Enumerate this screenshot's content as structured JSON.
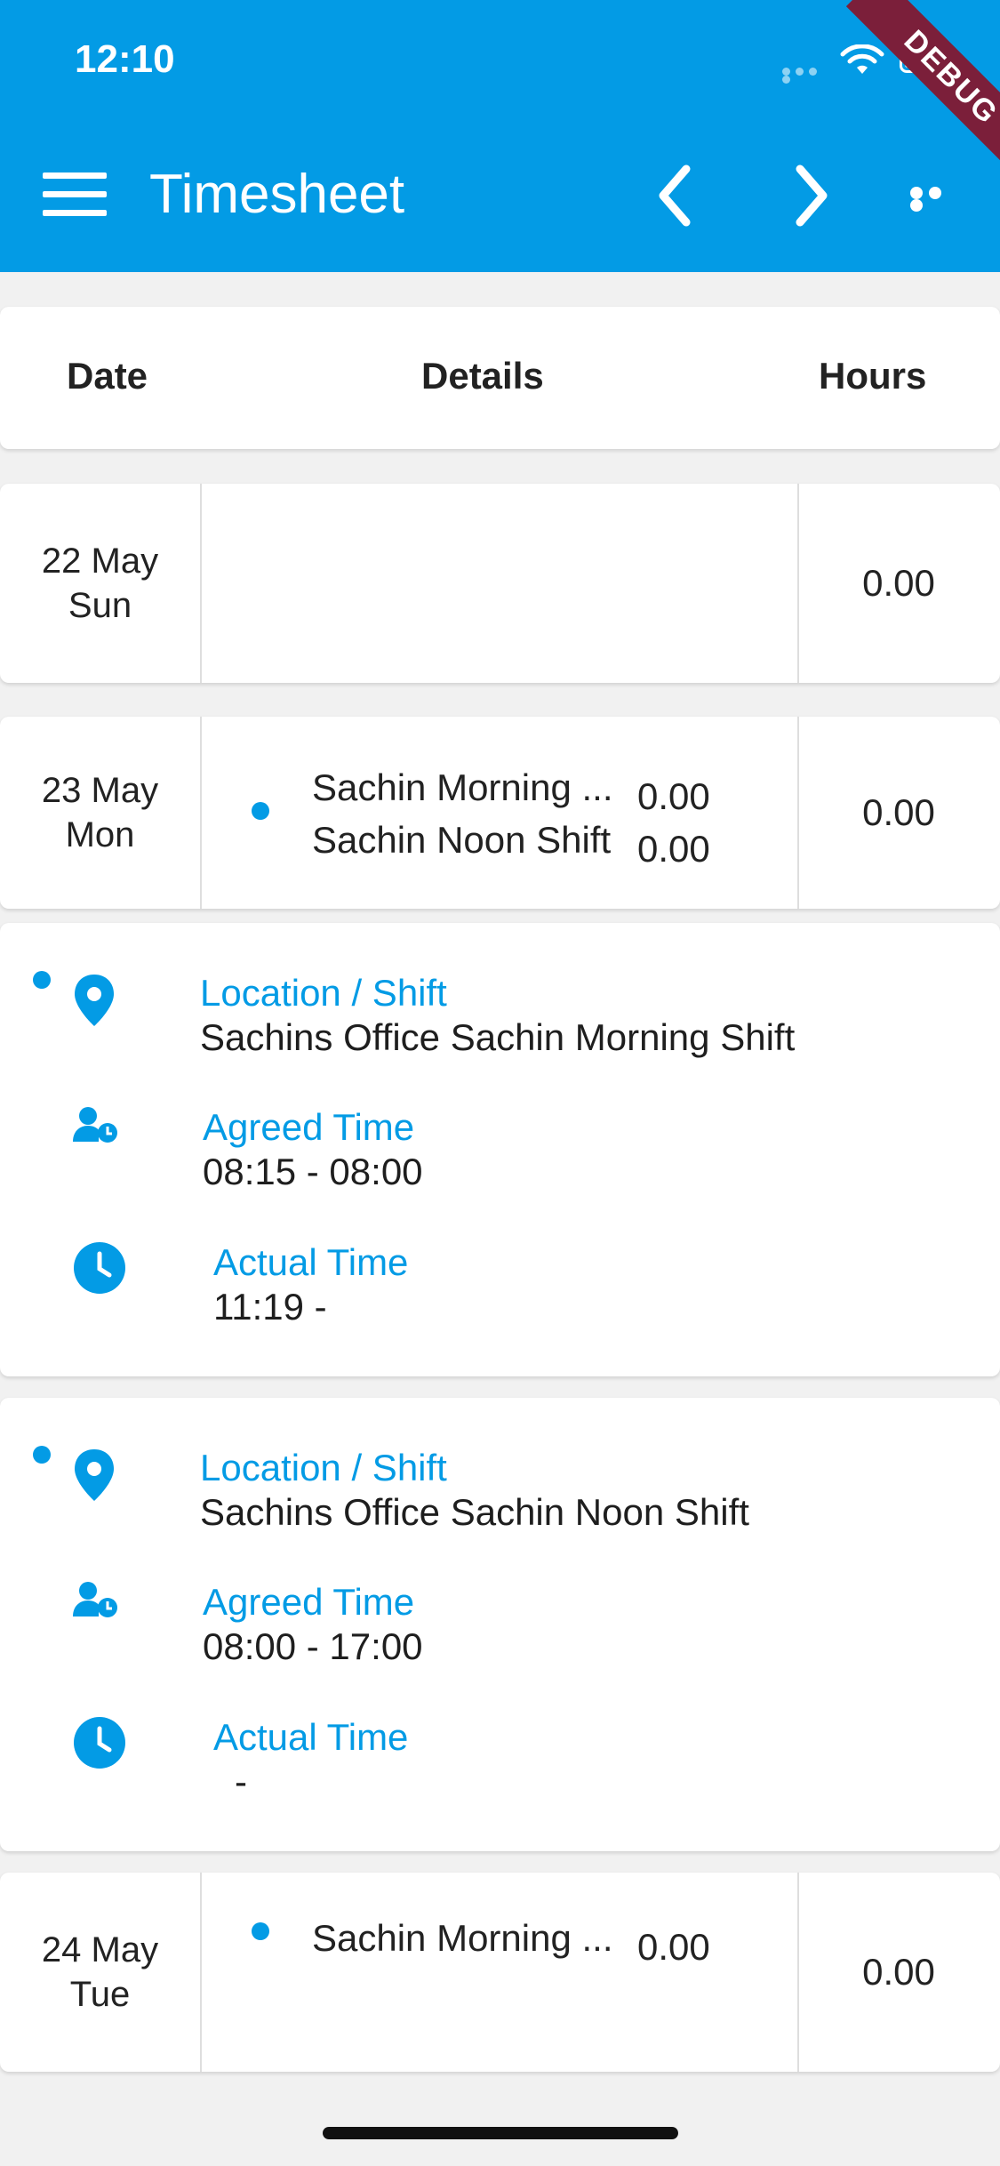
{
  "status_bar": {
    "time": "12:10",
    "debug_banner": "DEBUG"
  },
  "app_bar": {
    "menu_icon": "hamburger-menu-icon",
    "title": "Timesheet",
    "prev_icon": "chevron-left-icon",
    "next_icon": "chevron-right-icon",
    "more_icon": "more-horizontal-icon"
  },
  "table_header": {
    "date": "Date",
    "details": "Details",
    "hours": "Hours"
  },
  "colors": {
    "accent": "#039be5",
    "background": "#f1f1f1",
    "debug": "#7b1f3a"
  },
  "rows": [
    {
      "day": "22 May",
      "weekday": "Sun",
      "shifts": [],
      "hours": "0.00"
    },
    {
      "day": "23 May",
      "weekday": "Mon",
      "shifts": [
        {
          "name": "Sachin Morning ...",
          "hours": "0.00"
        },
        {
          "name": "Sachin Noon Shift",
          "hours": "0.00"
        }
      ],
      "hours": "0.00"
    },
    {
      "day": "24 May",
      "weekday": "Tue",
      "shifts": [
        {
          "name": "Sachin Morning ...",
          "hours": "0.00"
        }
      ],
      "hours": "0.00"
    }
  ],
  "details": [
    {
      "location_label": "Location / Shift",
      "location_value": "Sachins Office Sachin Morning Shift",
      "agreed_label": "Agreed Time",
      "agreed_value": "08:15 - 08:00",
      "actual_label": "Actual Time",
      "actual_value": "11:19 -"
    },
    {
      "location_label": "Location / Shift",
      "location_value": "Sachins Office Sachin Noon Shift",
      "agreed_label": "Agreed Time",
      "agreed_value": "08:00 - 17:00",
      "actual_label": "Actual Time",
      "actual_value": "-"
    }
  ]
}
